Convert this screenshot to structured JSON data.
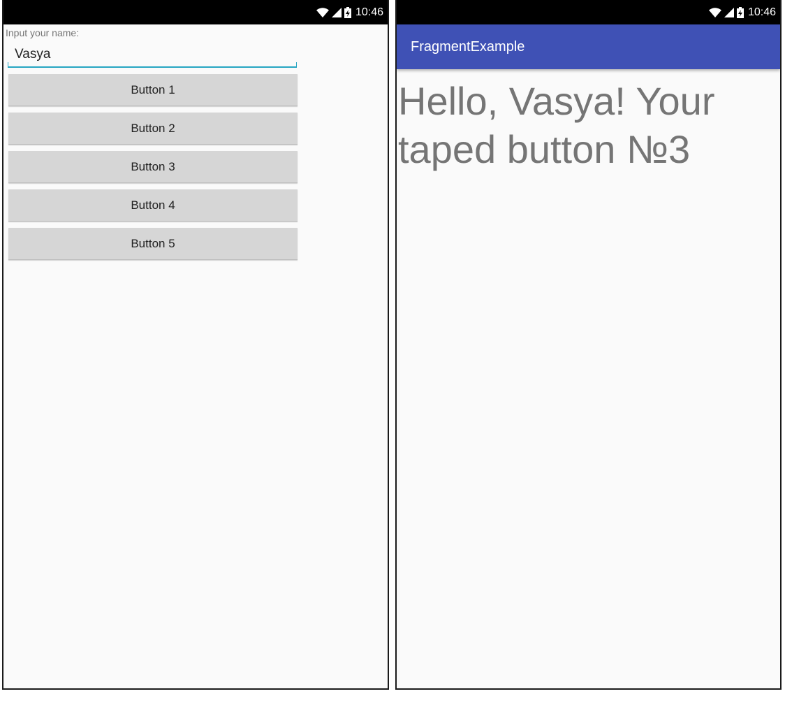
{
  "left_screen": {
    "status_bar": {
      "time": "10:46",
      "icons": [
        "wifi-icon",
        "signal-icon",
        "battery-charging-icon"
      ]
    },
    "name_label": "Input your name:",
    "name_input": {
      "value": "Vasya",
      "placeholder": ""
    },
    "buttons": [
      {
        "label": "Button 1"
      },
      {
        "label": "Button 2"
      },
      {
        "label": "Button 3"
      },
      {
        "label": "Button 4"
      },
      {
        "label": "Button 5"
      }
    ]
  },
  "right_screen": {
    "status_bar": {
      "time": "10:46",
      "icons": [
        "wifi-icon",
        "signal-icon",
        "battery-charging-icon"
      ]
    },
    "app_bar": {
      "title": "FragmentExample"
    },
    "message": "Hello, Vasya! Your taped button №3"
  },
  "colors": {
    "app_bar": "#3f51b5",
    "status_bar": "#000000",
    "input_underline": "#26a5c2",
    "button_bg": "#d6d6d6",
    "screen_bg": "#fafafa",
    "message_text": "#757575"
  }
}
